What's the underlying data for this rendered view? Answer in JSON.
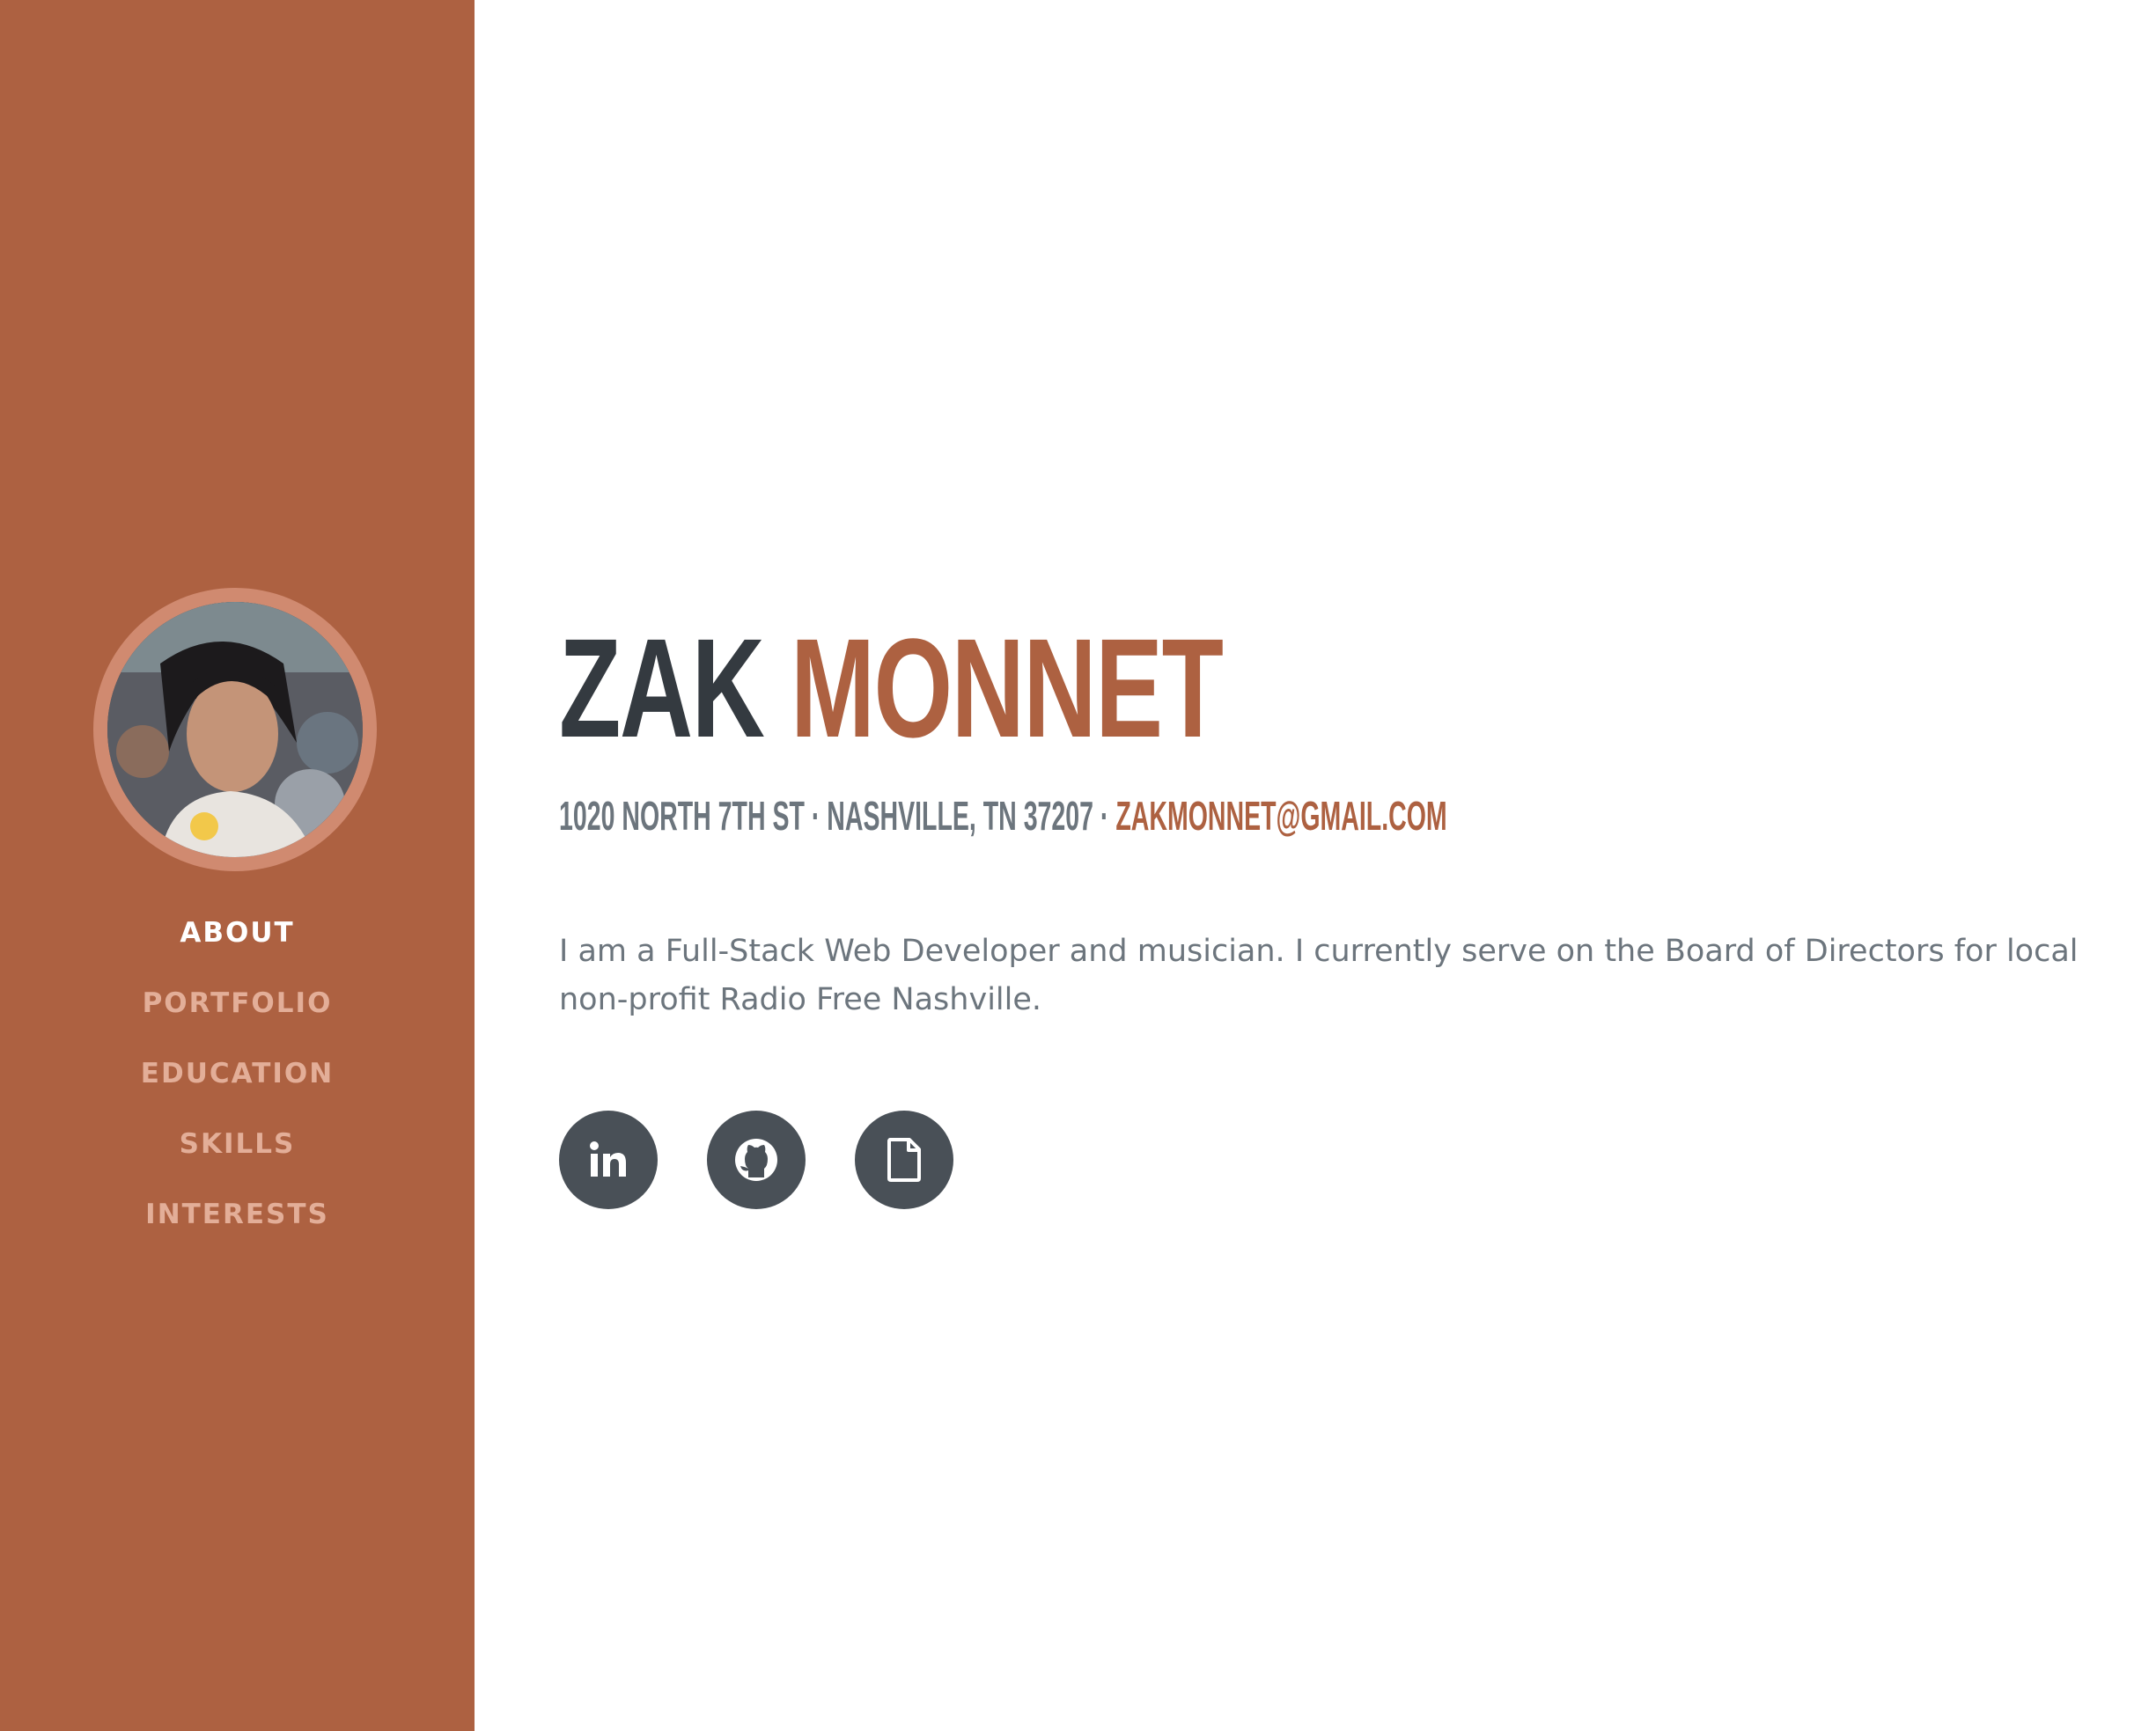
{
  "profile": {
    "photo_alt": "Profile photo"
  },
  "nav": {
    "items": [
      {
        "label": "ABOUT",
        "active": true
      },
      {
        "label": "PORTFOLIO",
        "active": false
      },
      {
        "label": "EDUCATION",
        "active": false
      },
      {
        "label": "SKILLS",
        "active": false
      },
      {
        "label": "INTERESTS",
        "active": false
      }
    ]
  },
  "about": {
    "first_name": "ZAK",
    "last_name": "MONNET",
    "address": "1020 NORTH 7TH ST · NASHVILLE, TN 37207 · ",
    "email": "ZAKMONNET@GMAIL.COM",
    "bio": "I am a Full-Stack Web Developer and musician. I currently serve on the Board of Directors for local non-profit Radio Free Nashville."
  },
  "social": [
    {
      "icon": "linkedin-icon"
    },
    {
      "icon": "github-icon"
    },
    {
      "icon": "file-icon"
    }
  ],
  "colors": {
    "sidebar": "#ad6141",
    "accent": "#ad6141",
    "heading_dark": "#343a40",
    "text_muted": "#6c757d",
    "social_bg": "#495057"
  }
}
